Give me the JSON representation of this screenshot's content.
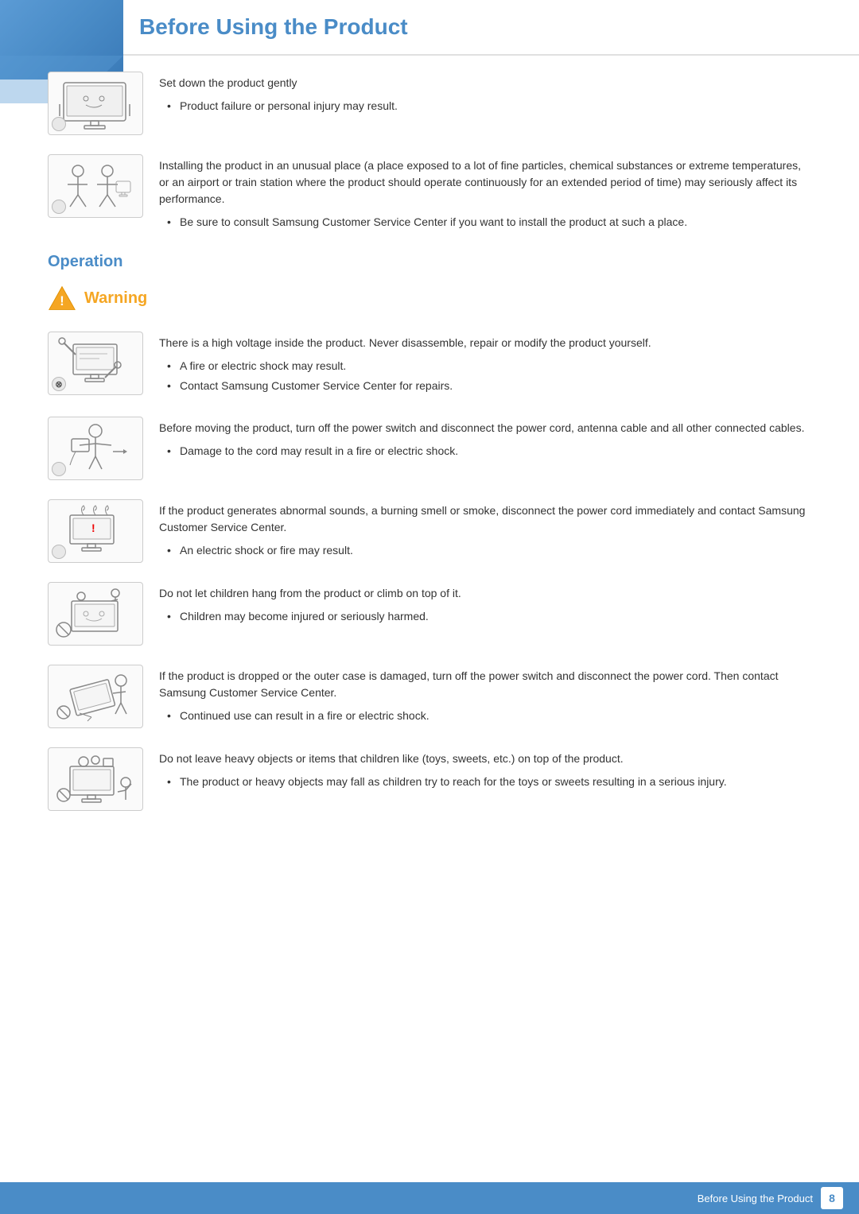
{
  "page": {
    "title": "Before Using the Product",
    "footer_label": "Before Using the Product",
    "page_number": "8"
  },
  "sections": {
    "operation_label": "Operation",
    "warning_label": "Warning"
  },
  "instructions": [
    {
      "id": "set-down",
      "main_text": "Set down the product gently",
      "bullets": [
        "Product failure or personal injury may result."
      ]
    },
    {
      "id": "unusual-place",
      "main_text": "Installing the product in an unusual place (a place exposed to a lot of fine particles, chemical substances or extreme temperatures, or an airport or train station where the product should operate continuously for an extended period of time) may seriously affect its performance.",
      "bullets": [
        "Be sure to consult Samsung Customer Service Center if you want to install the product at such a place."
      ]
    }
  ],
  "warnings": [
    {
      "id": "high-voltage",
      "main_text": "There is a high voltage inside the product. Never disassemble, repair or modify the product yourself.",
      "bullets": [
        "A fire or electric shock may result.",
        "Contact Samsung Customer Service Center for repairs."
      ]
    },
    {
      "id": "moving-product",
      "main_text": "Before moving the product, turn off the power switch and disconnect the power cord, antenna cable and all other connected cables.",
      "bullets": [
        "Damage to the cord may result in a fire or electric shock."
      ]
    },
    {
      "id": "abnormal-sounds",
      "main_text": "If the product generates abnormal sounds, a burning smell or smoke, disconnect the power cord immediately and contact Samsung Customer Service Center.",
      "bullets": [
        "An electric shock or fire may result."
      ]
    },
    {
      "id": "children-hang",
      "main_text": "Do not let children hang from the product or climb on top of it.",
      "bullets": [
        "Children may become injured or seriously harmed."
      ]
    },
    {
      "id": "dropped",
      "main_text": "If the product is dropped or the outer case is damaged, turn off the power switch and disconnect the power cord. Then contact Samsung Customer Service Center.",
      "bullets": [
        "Continued use can result in a fire or electric shock."
      ]
    },
    {
      "id": "heavy-objects",
      "main_text": "Do not leave heavy objects or items that children like (toys, sweets, etc.) on top of the product.",
      "bullets": [
        "The product or heavy objects may fall as children try to reach for the toys or sweets resulting in a serious injury."
      ]
    }
  ]
}
